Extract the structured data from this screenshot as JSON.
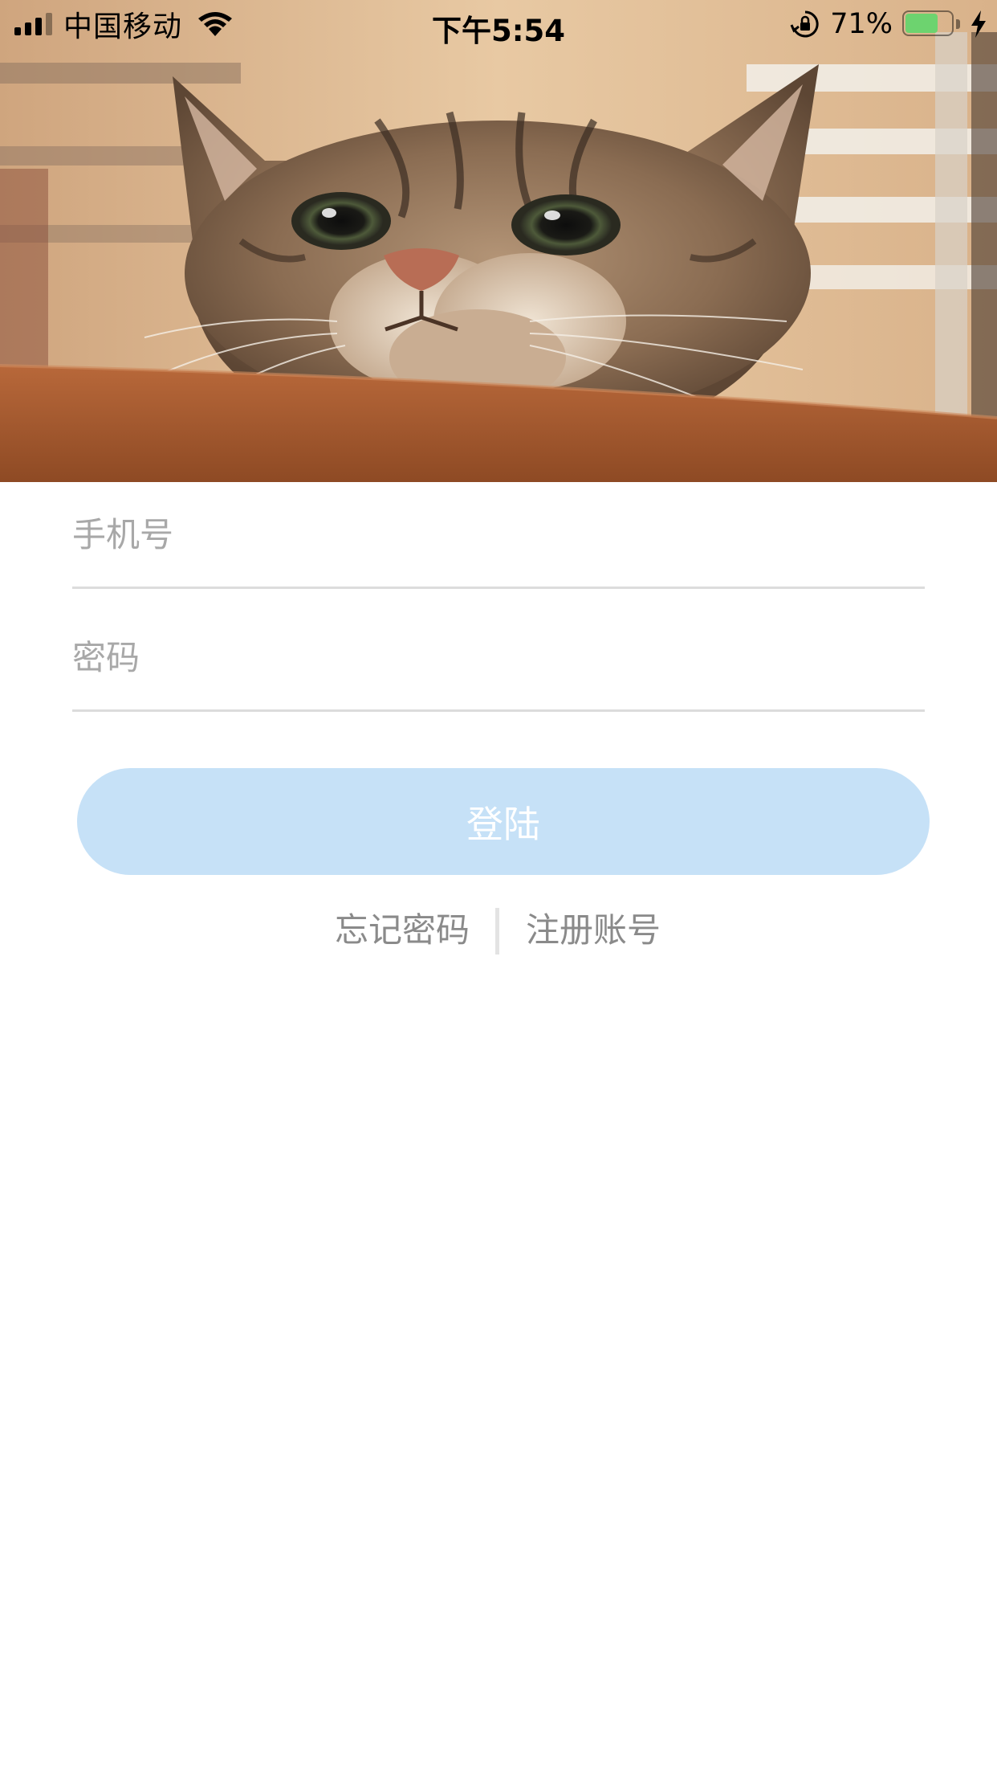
{
  "status_bar": {
    "carrier": "中国移动",
    "time": "下午5:54",
    "battery_percent_label": "71%",
    "battery_level": 0.71,
    "icons": [
      "signal-icon",
      "wifi-icon",
      "rotation-lock-icon",
      "battery-icon",
      "charging-icon"
    ]
  },
  "hero": {
    "image": "cat-peeking-over-table-photo"
  },
  "form": {
    "phone_placeholder": "手机号",
    "phone_value": "",
    "password_placeholder": "密码",
    "password_value": "",
    "login_label": "登陆",
    "login_button_color": "#c6e1f7"
  },
  "links": {
    "forgot_password": "忘记密码",
    "register": "注册账号"
  }
}
